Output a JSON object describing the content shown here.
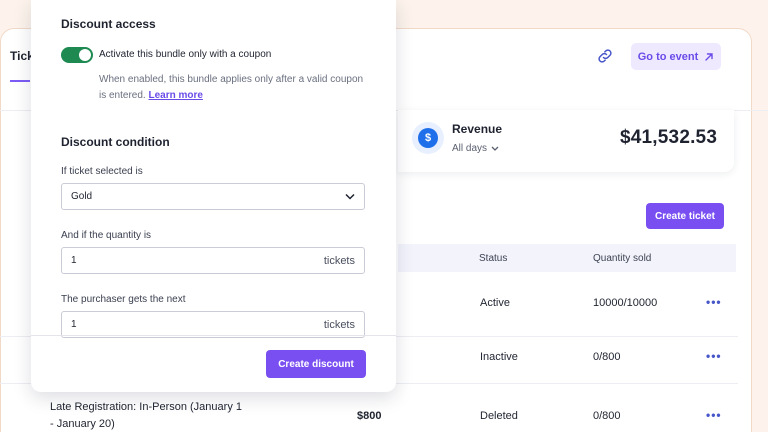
{
  "background": {
    "tab_label": "Tick",
    "goto_button": "Go to event",
    "revenue": {
      "label": "Revenue",
      "period": "All days",
      "amount": "$41,532.53",
      "currency_icon": "$"
    },
    "create_ticket_button": "Create ticket",
    "table": {
      "headers": {
        "status": "Status",
        "quantity_sold": "Quantity sold"
      },
      "rows": [
        {
          "name_line1": "",
          "name_line2": "",
          "price": "",
          "status": "Active",
          "quantity": "10000/10000"
        },
        {
          "name_line1": "",
          "name_line2": "",
          "price": "",
          "status": "Inactive",
          "quantity": "0/800"
        },
        {
          "name_line1": "Late Registration: In-Person (January 1",
          "name_line2": "- January 20)",
          "price": "$800",
          "status": "Deleted",
          "quantity": "0/800"
        }
      ],
      "row_menu_icon": "•••"
    }
  },
  "panel": {
    "discount_access": {
      "title": "Discount access",
      "toggle_label": "Activate this bundle only with a coupon",
      "toggle_on": true,
      "help_text": "When enabled, this bundle applies only after a valid coupon is entered.",
      "learn_more": "Learn more"
    },
    "discount_condition": {
      "title": "Discount condition",
      "ticket_label": "If ticket selected is",
      "ticket_value": "Gold",
      "quantity_label": "And if the quantity is",
      "quantity_value": "1",
      "quantity_suffix": "tickets",
      "next_label": "The purchaser gets the next",
      "next_value": "1",
      "next_suffix": "tickets"
    },
    "create_discount_button": "Create discount"
  },
  "colors": {
    "accent": "#7a4ff2",
    "toggle": "#1e8a52",
    "link": "#6a4be8"
  }
}
